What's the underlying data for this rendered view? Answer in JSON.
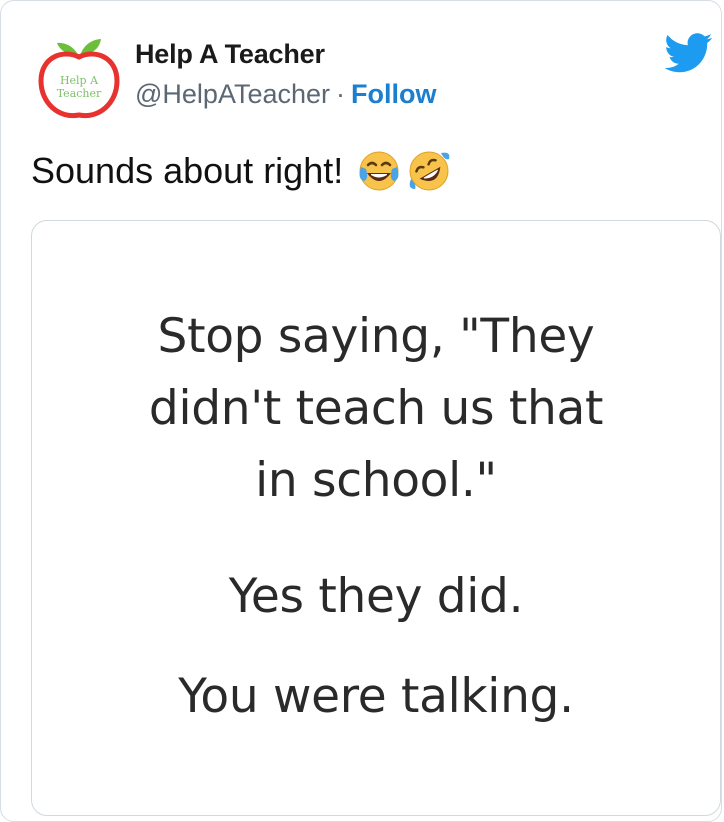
{
  "tweet": {
    "author_name": "Help A Teacher",
    "handle": "@HelpATeacher",
    "separator": "·",
    "follow_label": "Follow",
    "text": "Sounds about right!",
    "emojis": [
      "face-with-tears-of-joy",
      "rolling-on-the-floor-laughing"
    ],
    "avatar_text": [
      "Help A",
      "Teacher"
    ],
    "colors": {
      "follow": "#1b7fd0",
      "twitter_bird": "#1d9bf0",
      "apple_red": "#e8322f",
      "leaf_green": "#6cbf3a"
    }
  },
  "media": {
    "lines": [
      "Stop saying, \"They",
      "didn't teach us that",
      "in school.\"",
      "Yes they did.",
      "You were talking."
    ]
  }
}
